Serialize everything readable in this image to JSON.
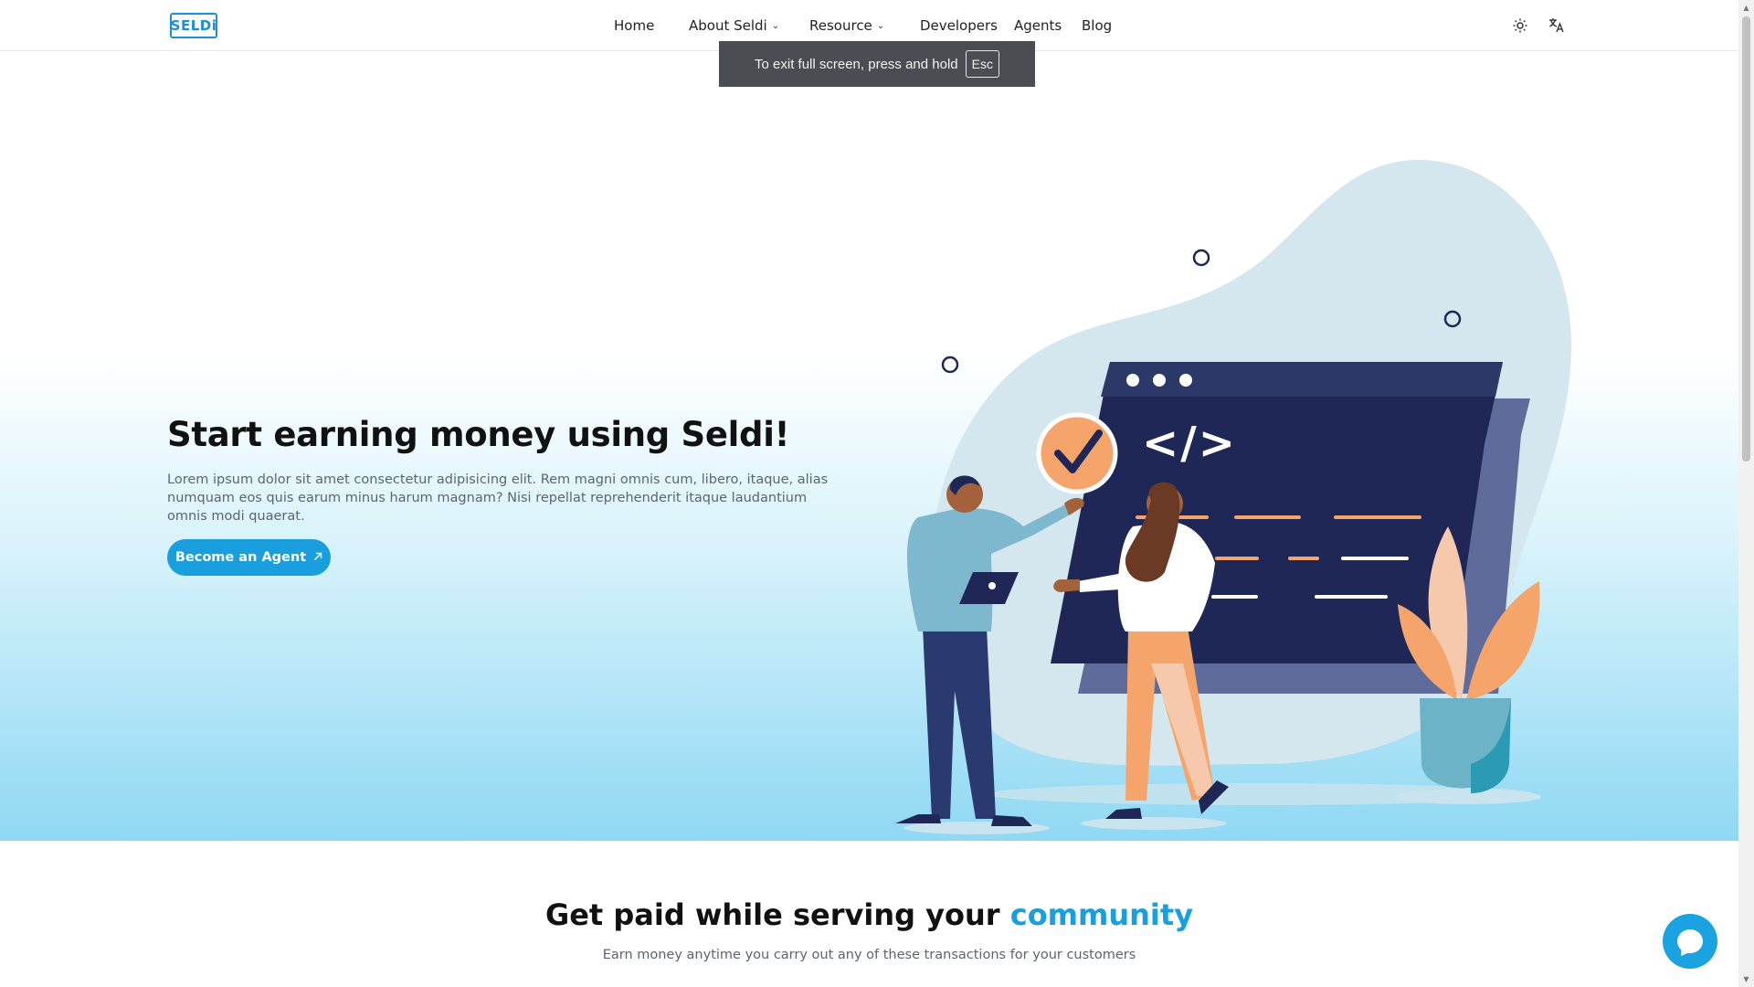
{
  "header": {
    "logo_text": "SELDi",
    "nav": [
      {
        "label": "Home",
        "has_dropdown": false
      },
      {
        "label": "About Seldi",
        "has_dropdown": true
      },
      {
        "label": "Resource",
        "has_dropdown": true
      },
      {
        "label": "Developers",
        "has_dropdown": false
      },
      {
        "label": "Agents",
        "has_dropdown": false
      },
      {
        "label": "Blog",
        "has_dropdown": false
      }
    ],
    "icons": [
      "theme-toggle-icon",
      "language-icon"
    ]
  },
  "fullscreen_toast": {
    "message": "To exit full screen, press and hold",
    "key": "Esc"
  },
  "hero": {
    "title": "Start earning money using Seldi!",
    "description": "Lorem ipsum dolor sit amet consectetur adipisicing elit. Rem magni omnis cum, libero, itaque, alias numquam eos quis earum minus harum magnam? Nisi repellat reprehenderit itaque laudantium omnis modi quaerat.",
    "cta_label": "Become an Agent",
    "cta_icon": "arrow-up-right-icon",
    "illustration_code_symbol": "</>"
  },
  "section": {
    "title_main": "Get paid while serving your",
    "title_accent": "community",
    "subtitle": "Earn money anytime you carry out any of these transactions for your customers"
  },
  "colors": {
    "brand": "#1a9fde",
    "hero_gradient_bottom": "#8fd8f3",
    "screen_navy": "#1e2756",
    "accent_orange": "#f5a56b"
  }
}
